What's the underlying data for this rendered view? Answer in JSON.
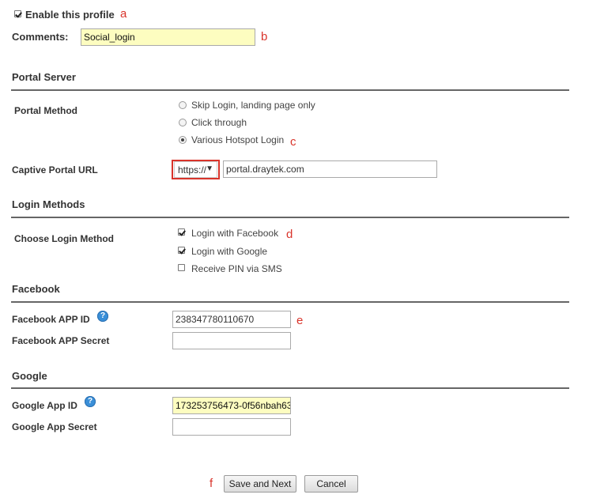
{
  "profile": {
    "enable_label": "Enable this profile",
    "enabled": true,
    "mark": "a"
  },
  "comments": {
    "label": "Comments:",
    "value": "Social_login",
    "mark": "b"
  },
  "portal_server": {
    "title": "Portal Server",
    "method_label": "Portal Method",
    "options": [
      {
        "label": "Skip Login, landing page only",
        "selected": false
      },
      {
        "label": "Click through",
        "selected": false
      },
      {
        "label": "Various Hotspot Login",
        "selected": true
      }
    ],
    "method_mark": "c",
    "url_label": "Captive Portal URL",
    "protocol": "https://",
    "url": "portal.draytek.com"
  },
  "login_methods": {
    "title": "Login Methods",
    "choose_label": "Choose Login Method",
    "options": [
      {
        "label": "Login with Facebook",
        "checked": true
      },
      {
        "label": "Login with Google",
        "checked": true
      },
      {
        "label": "Receive PIN via SMS",
        "checked": false
      }
    ],
    "mark": "d"
  },
  "facebook": {
    "title": "Facebook",
    "app_id_label": "Facebook APP ID",
    "app_id": "238347780110670",
    "app_id_mark": "e",
    "secret_label": "Facebook APP Secret",
    "secret": ""
  },
  "google": {
    "title": "Google",
    "app_id_label": "Google App ID",
    "app_id": "173253756473-0f56nbah63",
    "secret_label": "Google App Secret",
    "secret": ""
  },
  "actions": {
    "mark": "f",
    "save_next": "Save and Next",
    "cancel": "Cancel"
  },
  "icons": {
    "help": "help-question-icon",
    "dropdown": "dropdown-arrow-icon"
  },
  "colors": {
    "annotation": "#d9342b",
    "highlight_field": "#fdfdc0",
    "help_icon": "#3a8fd8"
  }
}
